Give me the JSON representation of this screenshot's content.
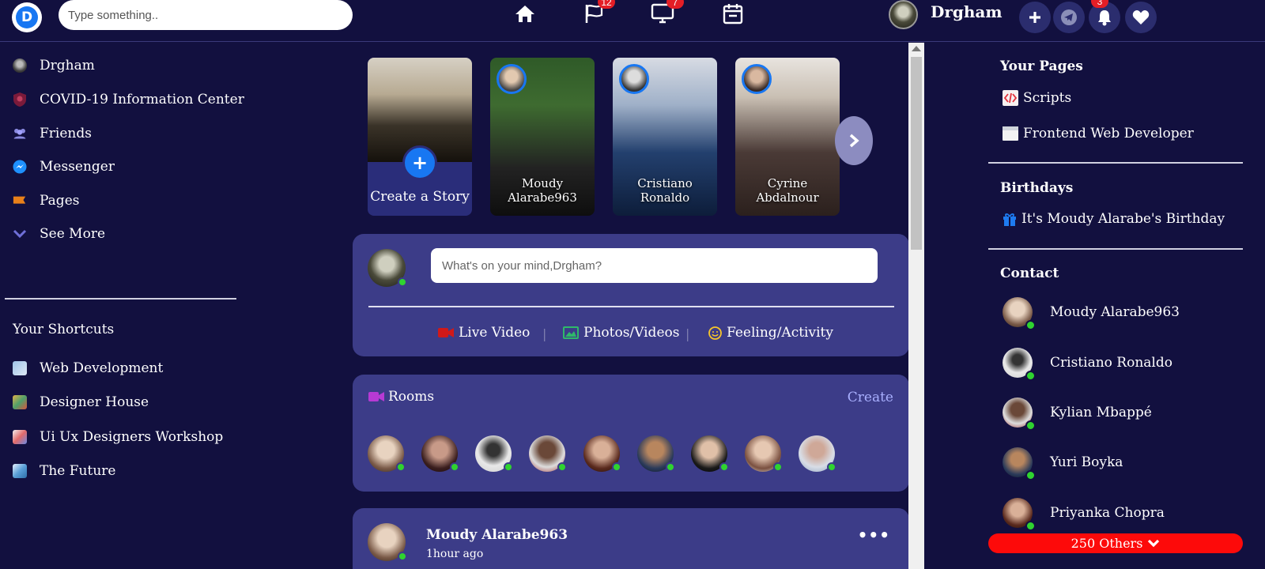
{
  "header": {
    "logo_letter": "D",
    "search_placeholder": "Type something..",
    "nav": [
      {
        "icon": "home-icon"
      },
      {
        "icon": "flag-icon",
        "badge": "12"
      },
      {
        "icon": "monitor-icon",
        "badge": "7"
      },
      {
        "icon": "calendar-icon"
      }
    ],
    "user_name": "Drgham",
    "actions": [
      {
        "icon": "plus-icon"
      },
      {
        "icon": "telegram-icon"
      },
      {
        "icon": "bell-icon",
        "badge": "3"
      },
      {
        "icon": "heart-icon"
      }
    ]
  },
  "left_sidebar": {
    "items": [
      {
        "label": "Drgham",
        "icon": "avatar-icon"
      },
      {
        "label": "COVID-19 Information Center",
        "icon": "shield-icon"
      },
      {
        "label": "Friends",
        "icon": "friends-icon"
      },
      {
        "label": "Messenger",
        "icon": "messenger-icon"
      },
      {
        "label": "Pages",
        "icon": "flag-icon"
      },
      {
        "label": "See More",
        "icon": "chevron-down-icon"
      }
    ],
    "shortcuts_title": "Your Shortcuts",
    "shortcuts": [
      {
        "label": "Web Development"
      },
      {
        "label": "Designer House"
      },
      {
        "label": "Ui Ux Designers Workshop"
      },
      {
        "label": "The Future"
      }
    ]
  },
  "stories": {
    "create_label": "Create a Story",
    "items": [
      {
        "name_line1": "Moudy",
        "name_line2": "Alarabe963"
      },
      {
        "name_line1": "Cristiano",
        "name_line2": "Ronaldo"
      },
      {
        "name_line1": "Cyrine",
        "name_line2": "Abdalnour"
      }
    ]
  },
  "composer": {
    "placeholder": "What's on your mind,Drgham?",
    "actions": [
      {
        "label": "Live Video",
        "icon": "video-camera-icon",
        "color": "#d01919"
      },
      {
        "label": "Photos/Videos",
        "icon": "image-icon",
        "color": "#2fb86a"
      },
      {
        "label": "Feeling/Activity",
        "icon": "smile-icon",
        "color": "#f7c52b"
      }
    ],
    "separator": "|"
  },
  "rooms": {
    "title": "Rooms",
    "create_label": "Create",
    "icon_color": "#b73ad4"
  },
  "post": {
    "author": "Moudy Alarabe963",
    "time": "1hour ago",
    "more": "•••"
  },
  "right_sidebar": {
    "pages_title": "Your Pages",
    "pages": [
      {
        "label": "Scripts",
        "icon": "code-icon"
      },
      {
        "label": "Frontend Web Developer",
        "icon": "page-icon"
      }
    ],
    "birthdays_title": "Birthdays",
    "birthday_text": "It's Moudy Alarabe's Birthday",
    "contacts_title": "Contact",
    "contacts": [
      {
        "name": "Moudy Alarabe963"
      },
      {
        "name": "Cristiano Ronaldo"
      },
      {
        "name": "Kylian Mbappé"
      },
      {
        "name": "Yuri Boyka"
      },
      {
        "name": "Priyanka Chopra"
      }
    ],
    "others_label": "250 Others"
  },
  "colors": {
    "background": "#12103f",
    "card": "#3c3c88",
    "accent": "#1877f2",
    "online": "#2fd32f",
    "badge": "#e41e26",
    "others_button": "#fd0a0a"
  }
}
